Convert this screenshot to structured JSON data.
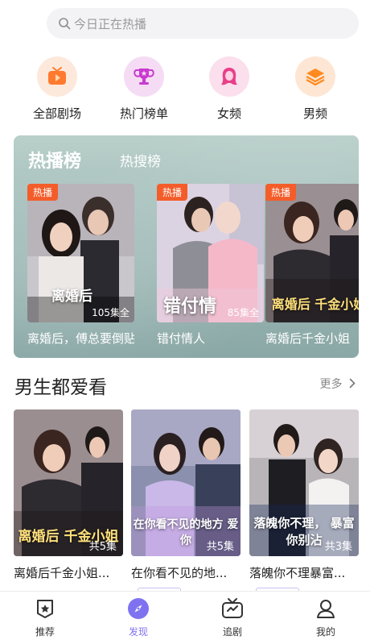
{
  "search": {
    "placeholder": "今日正在热播"
  },
  "categories": [
    {
      "label": "全部剧场",
      "icon": "tv-play-icon",
      "color": "#ff7a2e"
    },
    {
      "label": "热门榜单",
      "icon": "trophy-icon",
      "color": "#c93ad0"
    },
    {
      "label": "女频",
      "icon": "woman-icon",
      "color": "#e83f8a"
    },
    {
      "label": "男频",
      "icon": "layers-icon",
      "color": "#ff8a1f"
    }
  ],
  "hot": {
    "tab_active": "热播榜",
    "tab_inactive": "热搜榜",
    "items": [
      {
        "badge": "热播",
        "title": "离婚后，傅总要倒贴",
        "episodes": "105集全",
        "poster_text": "离婚后"
      },
      {
        "badge": "热播",
        "title": "错付情人",
        "episodes": "85集全",
        "poster_text": "错付情"
      },
      {
        "badge": "热播",
        "title": "离婚后千金小姐",
        "episodes": "",
        "poster_text": "离婚后 千金小姐"
      }
    ]
  },
  "section": {
    "title": "男生都爱看",
    "more": "更多"
  },
  "male_list": [
    {
      "title": "离婚后千金小姐...",
      "episodes": "共5集",
      "poster_text": "离婚后 千金小姐"
    },
    {
      "title": "在你看不见的地...",
      "episodes": "共5集",
      "poster_text": "在你看不见的地方 爱你"
    },
    {
      "title": "落魄你不理暴富...",
      "episodes": "共3集",
      "poster_text": "落魄你不理， 暴富你别沾"
    }
  ],
  "tabbar": [
    {
      "label": "推荐",
      "icon": "star-badge-icon",
      "active": false
    },
    {
      "label": "发现",
      "icon": "compass-icon",
      "active": true
    },
    {
      "label": "追剧",
      "icon": "tv-icon",
      "active": false
    },
    {
      "label": "我的",
      "icon": "user-icon",
      "active": false
    }
  ],
  "colors": {
    "accent": "#7f72f0",
    "badge": "#f45d2a",
    "panel": "#9fbab7"
  }
}
